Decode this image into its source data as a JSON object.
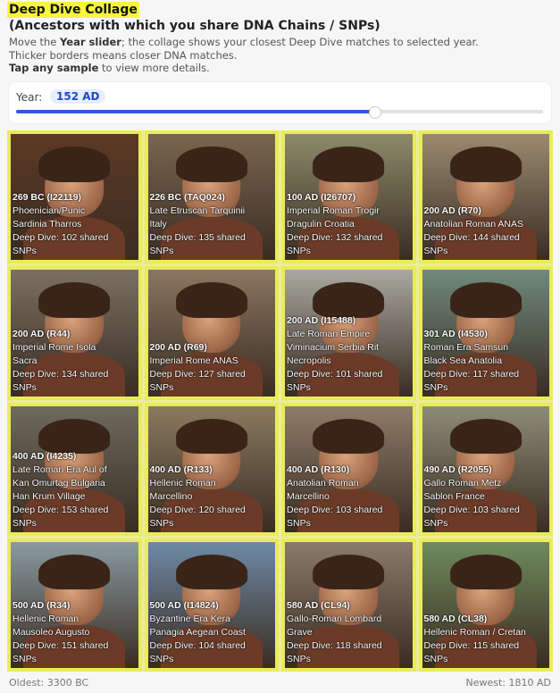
{
  "header": {
    "title": "Deep Dive Collage",
    "subtitle": "(Ancestors with which you share DNA Chains / SNPs)",
    "intro_1_a": "Move the ",
    "intro_1_b": "Year slider",
    "intro_1_c": "; the collage shows your closest Deep Dive matches to selected year.",
    "intro_2": "Thicker borders means closer DNA matches.",
    "intro_3_a": "Tap any sample",
    "intro_3_b": " to view more details."
  },
  "year": {
    "label": "Year:",
    "value": "152 AD",
    "slider_fraction": 0.68
  },
  "tiles": [
    {
      "date": "269 BC (I22119)",
      "l1": "Phoenician/Punic",
      "l2": "Sardinia Tharros",
      "l3": "Deep Dive: 102 shared",
      "l4": "SNPs",
      "bg": "#5c3a25"
    },
    {
      "date": "226 BC (TAQ024)",
      "l1": "Late Etruscan Tarquinii",
      "l2": "Italy",
      "l3": "Deep Dive: 135 shared",
      "l4": "SNPs",
      "bg": "#7a6650"
    },
    {
      "date": "100 AD (I26707)",
      "l1": "Imperial Roman Trogir",
      "l2": "Dragulin Croatia",
      "l3": "Deep Dive: 132 shared",
      "l4": "SNPs",
      "bg": "#8d8a6a"
    },
    {
      "date": "200 AD (R70)",
      "l1": "Anatolian Roman ANAS",
      "l2": "",
      "l3": "Deep Dive: 144 shared",
      "l4": "SNPs",
      "bg": "#9a8a70"
    },
    {
      "date": "200 AD (R44)",
      "l1": "Imperial Rome Isola",
      "l2": "Sacra",
      "l3": "Deep Dive: 134 shared",
      "l4": "SNPs",
      "bg": "#7b7064"
    },
    {
      "date": "200 AD (R69)",
      "l1": "Imperial Rome ANAS",
      "l2": "",
      "l3": "Deep Dive: 127 shared",
      "l4": "SNPs",
      "bg": "#8a7660"
    },
    {
      "date": "200 AD (I15488)",
      "l1": "Late Roman Empire",
      "l2": "Viminacium Serbia Rit",
      "l3": "Necropolis",
      "l4": "Deep Dive: 101 shared",
      "l5": "SNPs",
      "bg": "#a9a8a0"
    },
    {
      "date": "301 AD (I4530)",
      "l1": "Roman Era Samsun",
      "l2": "Black Sea Anatolia",
      "l3": "Deep Dive: 117 shared",
      "l4": "SNPs",
      "bg": "#6f8a7c"
    },
    {
      "date": "400 AD (I4235)",
      "l1": "Late Roman Era Aul of",
      "l2": "Kan Omurtag Bulgaria",
      "l3": "Han Krum Village",
      "l4": "Deep Dive: 153 shared",
      "l5": "SNPs",
      "bg": "#6d6a5e"
    },
    {
      "date": "400 AD (R133)",
      "l1": "Hellenic Roman",
      "l2": "Marcellino",
      "l3": "Deep Dive: 120 shared",
      "l4": "SNPs",
      "bg": "#8a7a60"
    },
    {
      "date": "400 AD (R130)",
      "l1": "Anatolian Roman",
      "l2": "Marcellino",
      "l3": "Deep Dive: 103 shared",
      "l4": "SNPs",
      "bg": "#8e7c68"
    },
    {
      "date": "490 AD (R2055)",
      "l1": "Gallo Roman Metz",
      "l2": "Sablon France",
      "l3": "Deep Dive: 103 shared",
      "l4": "SNPs",
      "bg": "#8d8c78"
    },
    {
      "date": "500 AD (R34)",
      "l1": "Hellenic Roman",
      "l2": "Mausoleo Augusto",
      "l3": "Deep Dive: 151 shared",
      "l4": "SNPs",
      "bg": "#8a9aa0"
    },
    {
      "date": "500 AD (I14824)",
      "l1": "Byzantine Era Kera",
      "l2": "Panagia Aegean Coast",
      "l3": "Deep Dive: 104 shared",
      "l4": "SNPs",
      "bg": "#6e8aa4"
    },
    {
      "date": "580 AD (CL94)",
      "l1": "Gallo-Roman Lombard",
      "l2": "Grave",
      "l3": "Deep Dive: 118 shared",
      "l4": "SNPs",
      "bg": "#8a7a6a"
    },
    {
      "date": "580 AD (CL38)",
      "l1": "Hellenic Roman / Cretan",
      "l2": "",
      "l3": "Deep Dive: 115 shared",
      "l4": "SNPs",
      "bg": "#6f8a5c"
    }
  ],
  "footer": {
    "oldest": "Oldest: 3300 BC",
    "newest": "Newest: 1810 AD"
  }
}
